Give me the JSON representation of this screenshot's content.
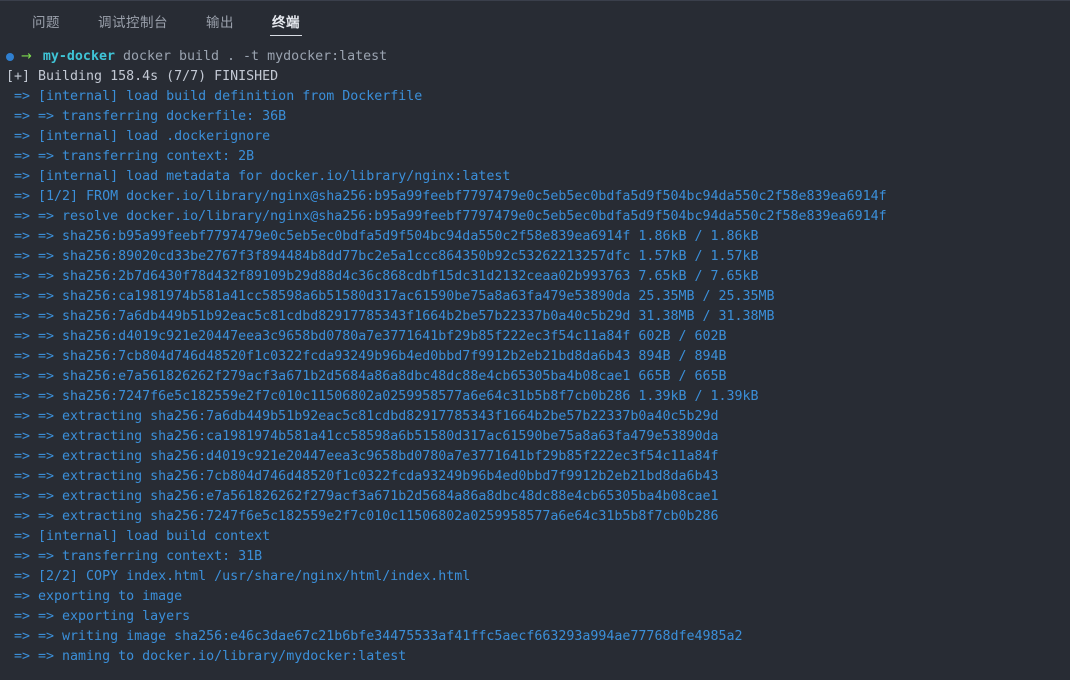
{
  "tabs": [
    {
      "label": "问题",
      "active": false
    },
    {
      "label": "调试控制台",
      "active": false
    },
    {
      "label": "输出",
      "active": false
    },
    {
      "label": "终端",
      "active": true
    }
  ],
  "colors": {
    "background": "#282c34",
    "tab_active_text": "#e6e9ef",
    "tab_inactive_text": "#9aa0ab",
    "prompt_dot": "#2f7fd0",
    "prompt_arrow": "#7ddc4e",
    "prompt_cwd": "#3fc4d6",
    "command_text": "#9aa3b0",
    "build_step_text": "#3b8fd9",
    "build_header_text": "#c3c9d4"
  },
  "terminal": {
    "prompt": {
      "status_icon": "filled-circle",
      "arrow_glyph": "→",
      "cwd": "my-docker",
      "command": "docker build . -t mydocker:latest"
    },
    "build_header": "[+] Building 158.4s (7/7) FINISHED",
    "lines": [
      " => [internal] load build definition from Dockerfile",
      " => => transferring dockerfile: 36B",
      " => [internal] load .dockerignore",
      " => => transferring context: 2B",
      " => [internal] load metadata for docker.io/library/nginx:latest",
      " => [1/2] FROM docker.io/library/nginx@sha256:b95a99feebf7797479e0c5eb5ec0bdfa5d9f504bc94da550c2f58e839ea6914f",
      " => => resolve docker.io/library/nginx@sha256:b95a99feebf7797479e0c5eb5ec0bdfa5d9f504bc94da550c2f58e839ea6914f",
      " => => sha256:b95a99feebf7797479e0c5eb5ec0bdfa5d9f504bc94da550c2f58e839ea6914f 1.86kB / 1.86kB",
      " => => sha256:89020cd33be2767f3f894484b8dd77bc2e5a1ccc864350b92c53262213257dfc 1.57kB / 1.57kB",
      " => => sha256:2b7d6430f78d432f89109b29d88d4c36c868cdbf15dc31d2132ceaa02b993763 7.65kB / 7.65kB",
      " => => sha256:ca1981974b581a41cc58598a6b51580d317ac61590be75a8a63fa479e53890da 25.35MB / 25.35MB",
      " => => sha256:7a6db449b51b92eac5c81cdbd82917785343f1664b2be57b22337b0a40c5b29d 31.38MB / 31.38MB",
      " => => sha256:d4019c921e20447eea3c9658bd0780a7e3771641bf29b85f222ec3f54c11a84f 602B / 602B",
      " => => sha256:7cb804d746d48520f1c0322fcda93249b96b4ed0bbd7f9912b2eb21bd8da6b43 894B / 894B",
      " => => sha256:e7a561826262f279acf3a671b2d5684a86a8dbc48dc88e4cb65305ba4b08cae1 665B / 665B",
      " => => sha256:7247f6e5c182559e2f7c010c11506802a0259958577a6e64c31b5b8f7cb0b286 1.39kB / 1.39kB",
      " => => extracting sha256:7a6db449b51b92eac5c81cdbd82917785343f1664b2be57b22337b0a40c5b29d",
      " => => extracting sha256:ca1981974b581a41cc58598a6b51580d317ac61590be75a8a63fa479e53890da",
      " => => extracting sha256:d4019c921e20447eea3c9658bd0780a7e3771641bf29b85f222ec3f54c11a84f",
      " => => extracting sha256:7cb804d746d48520f1c0322fcda93249b96b4ed0bbd7f9912b2eb21bd8da6b43",
      " => => extracting sha256:e7a561826262f279acf3a671b2d5684a86a8dbc48dc88e4cb65305ba4b08cae1",
      " => => extracting sha256:7247f6e5c182559e2f7c010c11506802a0259958577a6e64c31b5b8f7cb0b286",
      " => [internal] load build context",
      " => => transferring context: 31B",
      " => [2/2] COPY index.html /usr/share/nginx/html/index.html",
      " => exporting to image",
      " => => exporting layers",
      " => => writing image sha256:e46c3dae67c21b6bfe34475533af41ffc5aecf663293a994ae77768dfe4985a2",
      " => => naming to docker.io/library/mydocker:latest"
    ]
  }
}
